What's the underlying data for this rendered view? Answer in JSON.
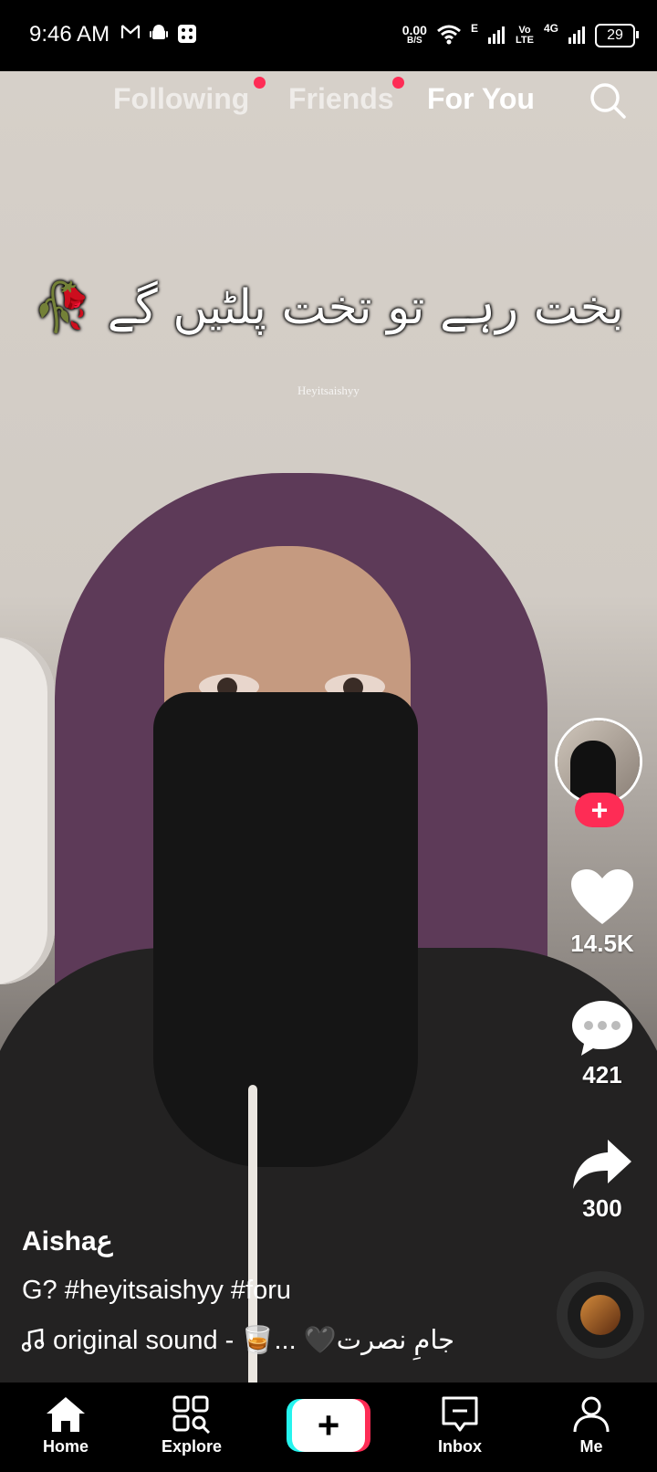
{
  "status_bar": {
    "time": "9:46 AM",
    "net_speed": "0.00",
    "net_unit": "B/S",
    "signal_e": "E",
    "volte": "Vo LTE",
    "signal_4g": "4G",
    "battery": "29"
  },
  "top_tabs": [
    {
      "label": "Following",
      "active": false,
      "has_dot": true
    },
    {
      "label": "Friends",
      "active": false,
      "has_dot": true
    },
    {
      "label": "For You",
      "active": true,
      "has_dot": false
    }
  ],
  "video": {
    "caption_text": "بخت رہے تو تخت پلٹیں گے 🥀",
    "watermark": "Heyitsaishyy"
  },
  "actions": {
    "likes": "14.5K",
    "comments": "421",
    "shares": "300"
  },
  "post": {
    "username": "Aishaع",
    "description": "G? #heyitsaishyy #foru",
    "sound": "original sound - 🥃... 🖤جامِ نصرت"
  },
  "nav": [
    {
      "label": "Home",
      "icon": "home-icon"
    },
    {
      "label": "Explore",
      "icon": "explore-icon"
    },
    {
      "label": "",
      "icon": "create-plus-icon"
    },
    {
      "label": "Inbox",
      "icon": "inbox-icon"
    },
    {
      "label": "Me",
      "icon": "profile-icon"
    }
  ],
  "colors": {
    "accent": "#fe2c55",
    "cyan": "#25f4ee"
  }
}
